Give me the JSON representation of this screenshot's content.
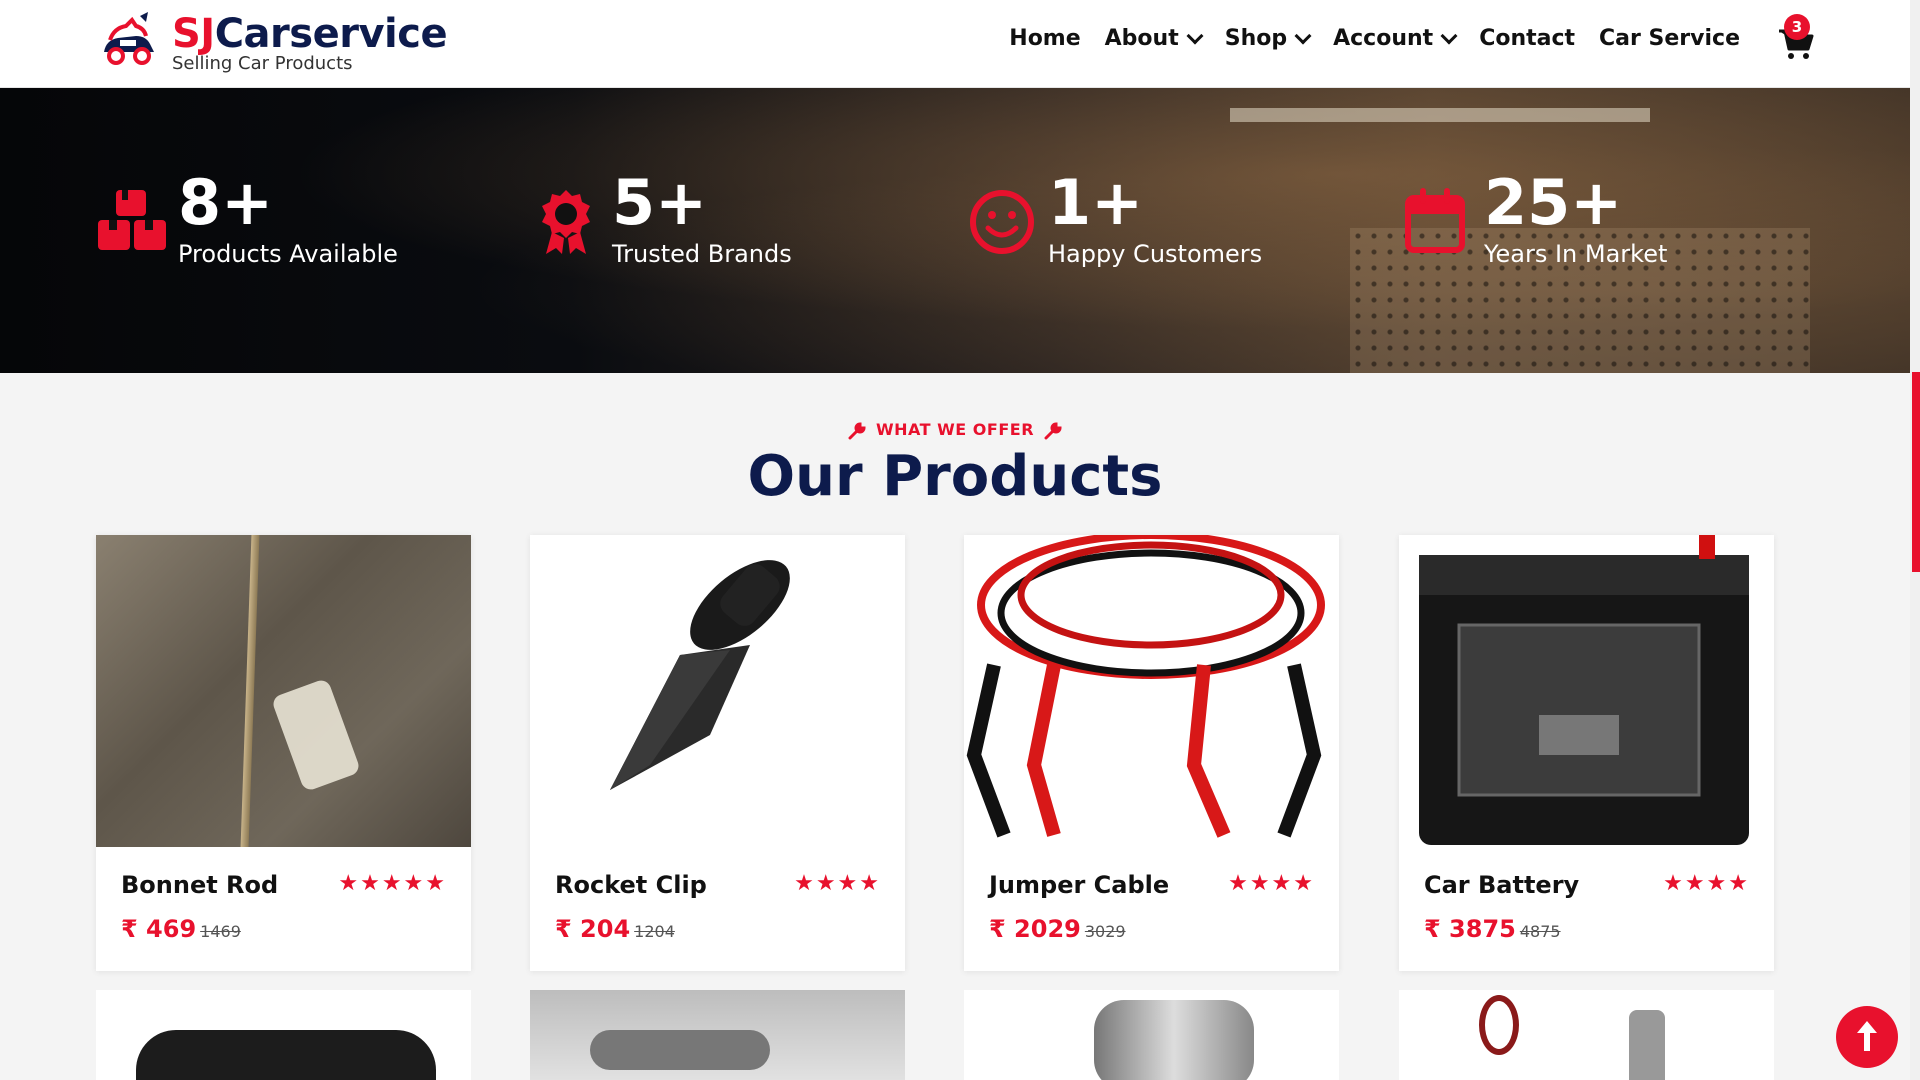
{
  "brand": {
    "prefix": "SJ",
    "name": "Carservice",
    "tagline": "Selling Car Products"
  },
  "nav": {
    "home": "Home",
    "about": "About",
    "shop": "Shop",
    "account": "Account",
    "contact": "Contact",
    "car_service": "Car Service",
    "cart_count": "3"
  },
  "stats": [
    {
      "value": "8+",
      "label": "Products Available",
      "icon": "boxes-icon"
    },
    {
      "value": "5+",
      "label": "Trusted Brands",
      "icon": "award-icon"
    },
    {
      "value": "1+",
      "label": "Happy Customers",
      "icon": "smile-icon"
    },
    {
      "value": "25+",
      "label": "Years In Market",
      "icon": "calendar-icon"
    }
  ],
  "section": {
    "eyebrow": "WHAT WE OFFER",
    "title": "Our Products"
  },
  "products": [
    {
      "name": "Bonnet Rod",
      "stars": "★★★★★",
      "price": "₹ 469",
      "old_price": "1469"
    },
    {
      "name": "Rocket Clip",
      "stars": "★★★★",
      "price": "₹ 204",
      "old_price": "1204"
    },
    {
      "name": "Jumper Cable",
      "stars": "★★★★",
      "price": "₹ 2029",
      "old_price": "3029"
    },
    {
      "name": "Car Battery",
      "stars": "★★★★",
      "price": "₹ 3875",
      "old_price": "4875"
    }
  ],
  "colors": {
    "accent": "#e8112d",
    "navy": "#0d1b4c"
  }
}
